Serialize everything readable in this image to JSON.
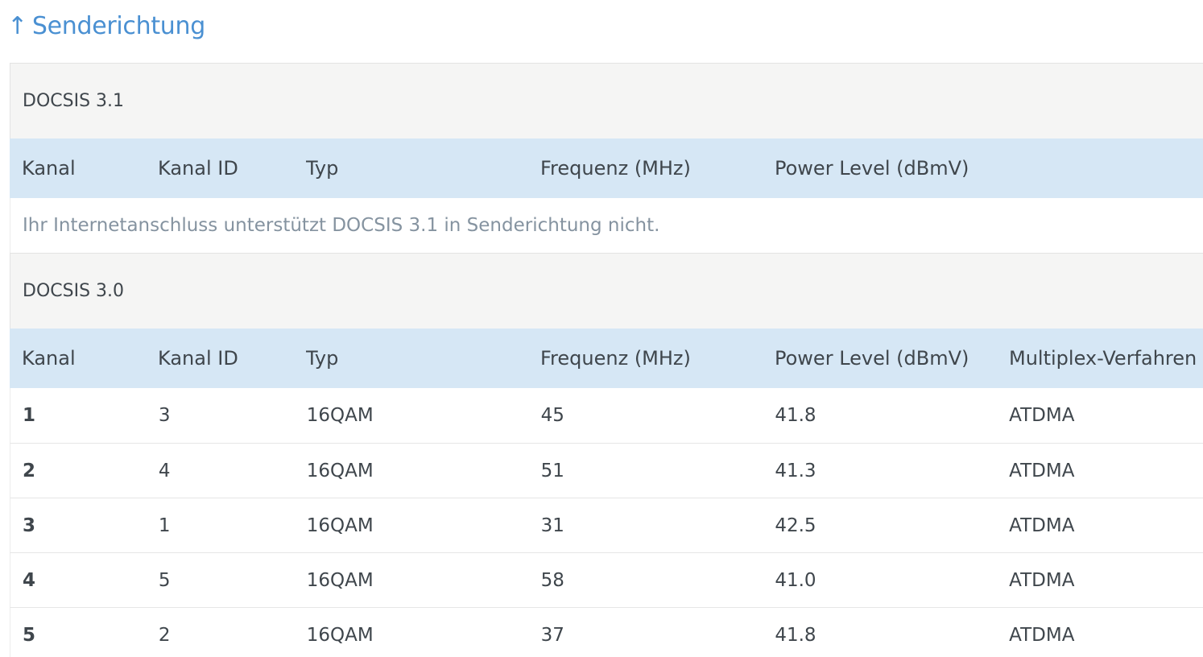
{
  "section": {
    "arrow": "↑",
    "title": "Senderichtung"
  },
  "docsis31": {
    "title": "DOCSIS 3.1",
    "columns": [
      "Kanal",
      "Kanal ID",
      "Typ",
      "Frequenz (MHz)",
      "Power Level (dBmV)"
    ],
    "message": "Ihr Internetanschluss unterstützt DOCSIS 3.1 in Senderichtung nicht."
  },
  "docsis30": {
    "title": "DOCSIS 3.0",
    "columns": [
      "Kanal",
      "Kanal ID",
      "Typ",
      "Frequenz (MHz)",
      "Power Level (dBmV)",
      "Multiplex-Verfahren"
    ],
    "rows": [
      {
        "kanal": "1",
        "kanal_id": "3",
        "typ": "16QAM",
        "frequenz": "45",
        "power": "41.8",
        "multiplex": "ATDMA"
      },
      {
        "kanal": "2",
        "kanal_id": "4",
        "typ": "16QAM",
        "frequenz": "51",
        "power": "41.3",
        "multiplex": "ATDMA"
      },
      {
        "kanal": "3",
        "kanal_id": "1",
        "typ": "16QAM",
        "frequenz": "31",
        "power": "42.5",
        "multiplex": "ATDMA"
      },
      {
        "kanal": "4",
        "kanal_id": "5",
        "typ": "16QAM",
        "frequenz": "58",
        "power": "41.0",
        "multiplex": "ATDMA"
      },
      {
        "kanal": "5",
        "kanal_id": "2",
        "typ": "16QAM",
        "frequenz": "37",
        "power": "41.8",
        "multiplex": "ATDMA"
      }
    ]
  }
}
